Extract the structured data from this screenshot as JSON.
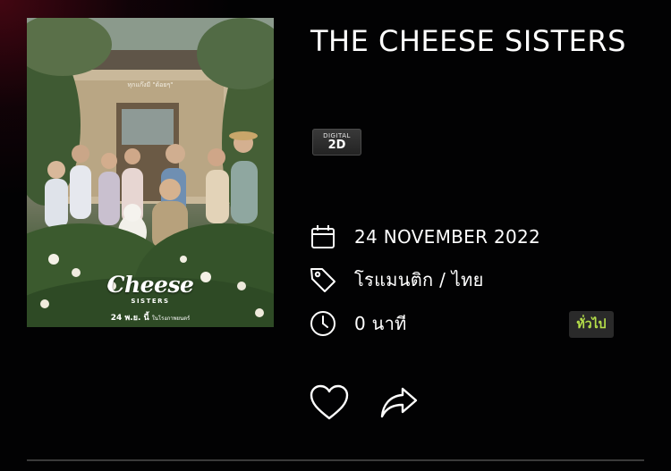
{
  "movie": {
    "title": "THE CHEESE SISTERS",
    "format_badge": {
      "line1": "DIGITAL",
      "line2": "2D"
    },
    "release_date": "24 NOVEMBER 2022",
    "genre": "โรแมนติก / ไทย",
    "duration": "0 นาที",
    "rating": "ทั่วไป",
    "rating_color": "#b6e04a"
  },
  "poster": {
    "tagline": "ทุกแก๊งมี \"ด้อยๆ\"",
    "logo": "Cheese",
    "logo_sub": "SISTERS",
    "date_text": "24 พ.ย. นี้",
    "date_sub": "ในโรงภาพยนตร์"
  },
  "actions": {
    "like_icon": "heart-icon",
    "share_icon": "share-icon"
  },
  "icons": {
    "date": "calendar-icon",
    "genre": "tag-icon",
    "duration": "clock-icon"
  },
  "colors": {
    "background": "#020203",
    "accent_glow": "#780a1e"
  }
}
